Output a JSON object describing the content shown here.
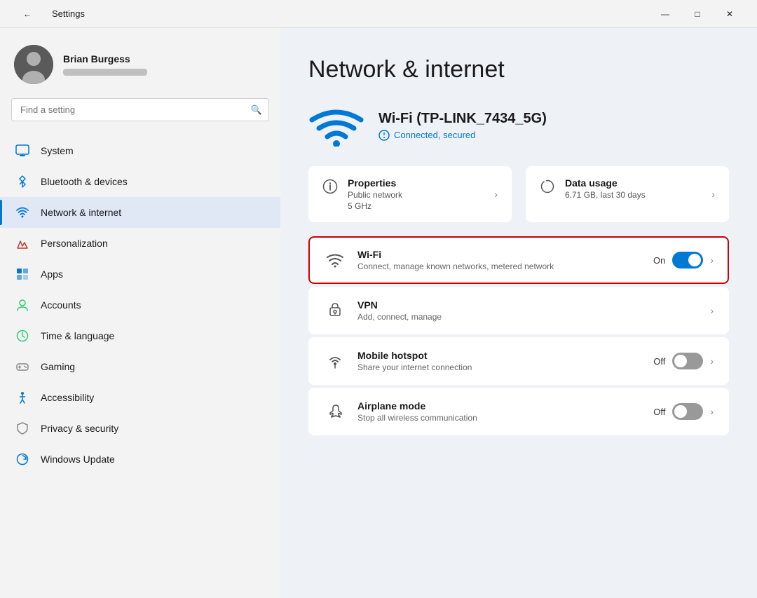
{
  "titlebar": {
    "title": "Settings",
    "back_label": "←",
    "minimize": "—",
    "maximize": "□",
    "close": "✕"
  },
  "sidebar": {
    "profile": {
      "name": "Brian Burgess"
    },
    "search": {
      "placeholder": "Find a setting",
      "value": ""
    },
    "items": [
      {
        "id": "system",
        "label": "System",
        "icon": "system"
      },
      {
        "id": "bluetooth",
        "label": "Bluetooth & devices",
        "icon": "bluetooth"
      },
      {
        "id": "network",
        "label": "Network & internet",
        "icon": "network",
        "active": true
      },
      {
        "id": "personalization",
        "label": "Personalization",
        "icon": "personalization"
      },
      {
        "id": "apps",
        "label": "Apps",
        "icon": "apps"
      },
      {
        "id": "accounts",
        "label": "Accounts",
        "icon": "accounts"
      },
      {
        "id": "time",
        "label": "Time & language",
        "icon": "time"
      },
      {
        "id": "gaming",
        "label": "Gaming",
        "icon": "gaming"
      },
      {
        "id": "accessibility",
        "label": "Accessibility",
        "icon": "accessibility"
      },
      {
        "id": "privacy",
        "label": "Privacy & security",
        "icon": "privacy"
      },
      {
        "id": "windows-update",
        "label": "Windows Update",
        "icon": "update"
      }
    ]
  },
  "main": {
    "title": "Network & internet",
    "wifi_hero": {
      "name": "Wi-Fi (TP-LINK_7434_5G)",
      "status": "Connected, secured"
    },
    "properties": {
      "label": "Properties",
      "sub1": "Public network",
      "sub2": "5 GHz"
    },
    "data_usage": {
      "label": "Data usage",
      "sub": "6.71 GB, last 30 days"
    },
    "items": [
      {
        "id": "wifi",
        "label": "Wi-Fi",
        "description": "Connect, manage known networks, metered network",
        "toggle": "on",
        "toggle_label": "On",
        "highlighted": true
      },
      {
        "id": "vpn",
        "label": "VPN",
        "description": "Add, connect, manage",
        "toggle": null,
        "highlighted": false
      },
      {
        "id": "hotspot",
        "label": "Mobile hotspot",
        "description": "Share your internet connection",
        "toggle": "off",
        "toggle_label": "Off",
        "highlighted": false
      },
      {
        "id": "airplane",
        "label": "Airplane mode",
        "description": "Stop all wireless communication",
        "toggle": "off",
        "toggle_label": "Off",
        "highlighted": false
      }
    ]
  }
}
